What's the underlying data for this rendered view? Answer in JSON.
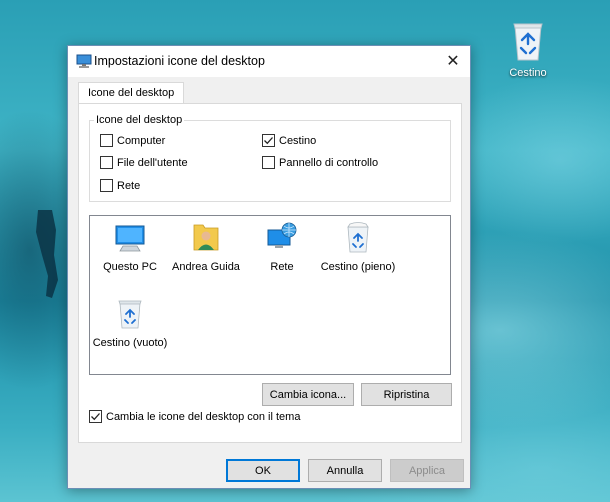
{
  "desktop": {
    "recycle_bin_label": "Cestino"
  },
  "window": {
    "title": "Impostazioni icone del desktop",
    "close_glyph": "✕"
  },
  "tabs": [
    {
      "label": "Icone del desktop",
      "active": true
    }
  ],
  "desktop_icons_group": {
    "legend": "Icone del desktop",
    "items": [
      {
        "label": "Computer",
        "checked": false
      },
      {
        "label": "Cestino",
        "checked": true
      },
      {
        "label": "File dell'utente",
        "checked": false
      },
      {
        "label": "Pannello di controllo",
        "checked": false
      },
      {
        "label": "Rete",
        "checked": false
      }
    ]
  },
  "icon_list": [
    {
      "label": "Questo PC",
      "icon": "monitor-icon"
    },
    {
      "label": "Andrea Guida",
      "icon": "user-folder-icon"
    },
    {
      "label": "Rete",
      "icon": "network-globe-icon"
    },
    {
      "label": "Cestino (pieno)",
      "icon": "recycle-bin-full-icon"
    },
    {
      "label": "Cestino (vuoto)",
      "icon": "recycle-bin-empty-icon"
    }
  ],
  "actions": {
    "change_icon": "Cambia icona...",
    "restore": "Ripristina"
  },
  "theme_option": {
    "label": "Cambia le icone del desktop con il tema",
    "checked": true
  },
  "footer": {
    "ok": "OK",
    "cancel": "Annulla",
    "apply": "Applica"
  },
  "colors": {
    "accent": "#0078d7",
    "window_bg": "#f0f0f0"
  }
}
